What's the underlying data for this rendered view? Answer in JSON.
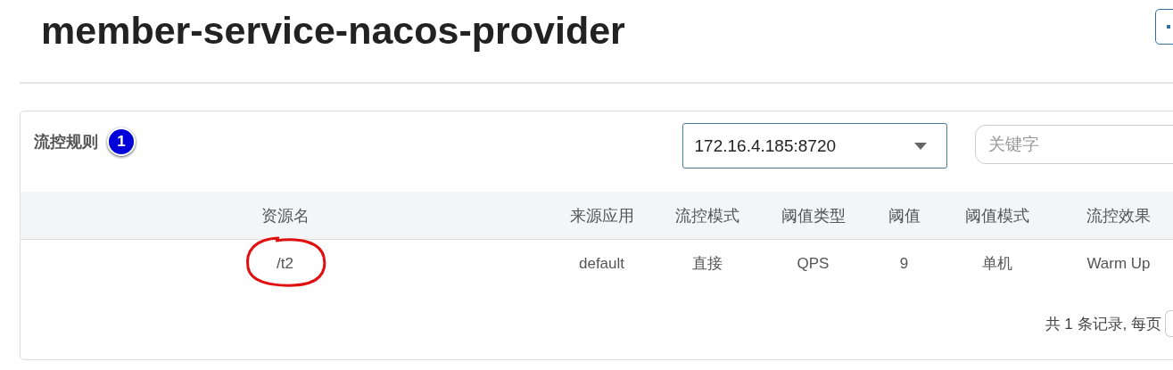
{
  "page_title": "member-service-nacos-provider",
  "panel": {
    "title": "流控规则",
    "badge": "1",
    "machine_select": {
      "value": "172.16.4.185:8720"
    },
    "search": {
      "placeholder": "关键字"
    }
  },
  "table": {
    "columns": [
      "资源名",
      "来源应用",
      "流控模式",
      "阈值类型",
      "阈值",
      "阈值模式",
      "流控效果"
    ],
    "rows": [
      {
        "cells": [
          "/t2",
          "default",
          "直接",
          "QPS",
          "9",
          "单机",
          "Warm Up"
        ],
        "circled": true
      }
    ]
  },
  "pagination": {
    "summary": "共 1 条记录, 每页"
  }
}
